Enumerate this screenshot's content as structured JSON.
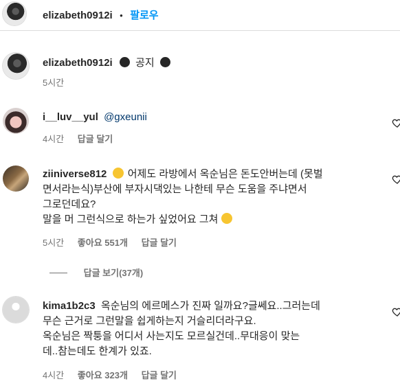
{
  "header": {
    "username": "elizabeth0912i",
    "separator": "•",
    "follow_label": "팔로우"
  },
  "caption": {
    "username": "elizabeth0912i",
    "text": "공지",
    "time": "5시간"
  },
  "comments": [
    {
      "username": "i__luv__yul",
      "lines": [
        "@gxeunii"
      ],
      "time": "4시간",
      "likes": "",
      "reply_label": "답글 달기"
    },
    {
      "username": "ziiniverse812",
      "lines": [
        "어제도 라방에서 옥순님은 돈도안버는데 (못벌",
        "면서라는식)부산에 부자시댁있는 나한테 무슨 도움을 주냐면서",
        "그로던데요?",
        "말을 머 그런식으로 하는가 싶었어요 그쳐"
      ],
      "time": "5시간",
      "likes": "좋아요 551개",
      "reply_label": "답글 달기",
      "view_replies": "답글 보기(37개)"
    },
    {
      "username": "kima1b2c3",
      "lines": [
        "옥순님의 에르메스가 진짜 일까요?글쎄요..그러는데",
        "무슨 근거로 그런말을 쉽게하는지 거슬리더라구요.",
        "옥순님은 짝퉁을 어디서 사는지도 모르실건데..무대응이 맞는",
        "데..참는데도 한계가 있죠."
      ],
      "time": "4시간",
      "likes": "좋아요 323개",
      "reply_label": "답글 달기"
    }
  ],
  "colors": {
    "accent": "#0095f6",
    "text": "#262626",
    "muted": "#737373",
    "border": "#dbdbdb"
  },
  "icons": [
    "heart-icon",
    "face-with-open-eyes-and-hand-over-mouth-emoji",
    "confused-face-emoji",
    "dot-icon"
  ]
}
